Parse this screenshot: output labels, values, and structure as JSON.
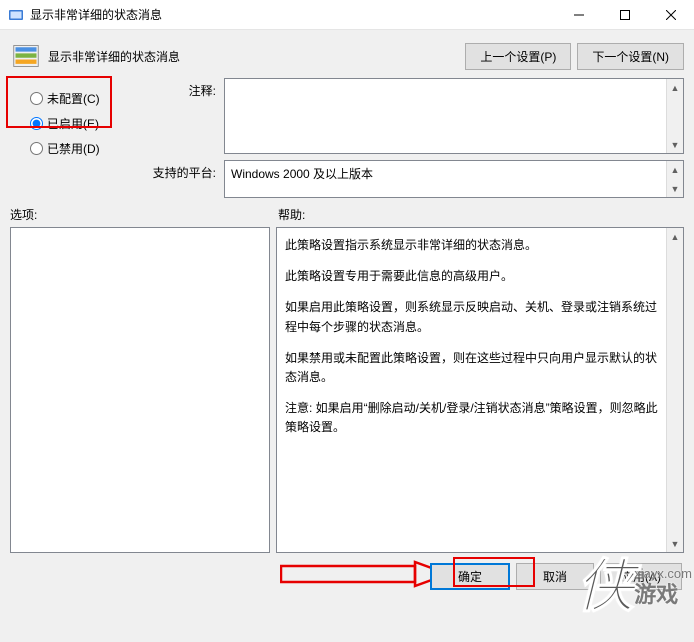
{
  "window": {
    "title": "显示非常详细的状态消息",
    "minimize": "—",
    "maximize": "□",
    "close": "✕"
  },
  "header": {
    "title": "显示非常详细的状态消息",
    "prev_btn": "上一个设置(P)",
    "next_btn": "下一个设置(N)"
  },
  "radios": {
    "not_configured": "未配置(C)",
    "enabled": "已启用(E)",
    "disabled": "已禁用(D)",
    "selected": "enabled"
  },
  "labels": {
    "comment": "注释:",
    "supported": "支持的平台:",
    "options": "选项:",
    "help": "帮助:"
  },
  "supported_text": "Windows 2000 及以上版本",
  "help": {
    "p1": "此策略设置指示系统显示非常详细的状态消息。",
    "p2": "此策略设置专用于需要此信息的高级用户。",
    "p3": "如果启用此策略设置，则系统显示反映启动、关机、登录或注销系统过程中每个步骤的状态消息。",
    "p4": "如果禁用或未配置此策略设置，则在这些过程中只向用户显示默认的状态消息。",
    "p5": "注意: 如果启用“删除启动/关机/登录/注销状态消息”策略设置，则忽略此策略设置。"
  },
  "footer": {
    "ok": "确定",
    "cancel": "取消",
    "apply": "应用(A)"
  },
  "watermark": {
    "char": "侠",
    "line1": "xiayx.com",
    "line2": "游戏"
  }
}
